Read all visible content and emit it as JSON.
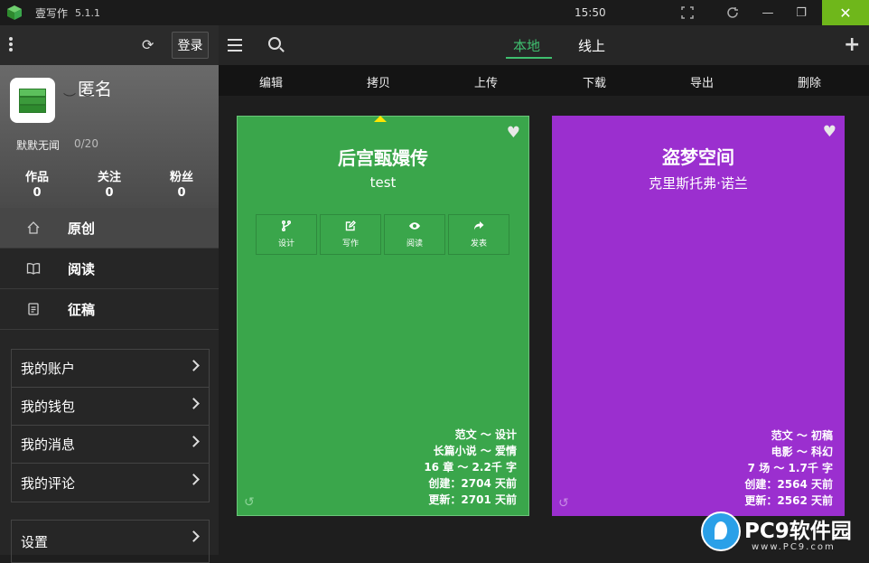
{
  "window": {
    "title": "壹写作",
    "version": "5.1.1",
    "clock": "15:50",
    "minimize": "—",
    "restore": "❐",
    "close": "✕"
  },
  "sidebar": {
    "login": "登录",
    "user": {
      "name": "匿名",
      "motto": "默默无闻",
      "motto_count": "0/20"
    },
    "stats": [
      {
        "label": "作品",
        "value": "0"
      },
      {
        "label": "关注",
        "value": "0"
      },
      {
        "label": "粉丝",
        "value": "0"
      }
    ],
    "nav": [
      {
        "label": "原创",
        "icon": "home-icon",
        "active": true
      },
      {
        "label": "阅读",
        "icon": "book-icon"
      },
      {
        "label": "征稿",
        "icon": "document-icon"
      }
    ],
    "account": [
      "我的账户",
      "我的钱包",
      "我的消息",
      "我的评论"
    ],
    "settings": "设置"
  },
  "topbar": {
    "tabs": [
      "本地",
      "线上"
    ],
    "active_tab": 0
  },
  "toolbar": [
    "编辑",
    "拷贝",
    "上传",
    "下载",
    "导出",
    "删除"
  ],
  "cards": [
    {
      "title": "后宫甄嬛传",
      "subtitle": "test",
      "color": "#3aa64b",
      "actions": [
        {
          "label": "设计",
          "icon": "branch-icon"
        },
        {
          "label": "写作",
          "icon": "edit-icon"
        },
        {
          "label": "阅读",
          "icon": "eye-icon"
        },
        {
          "label": "发表",
          "icon": "share-icon"
        }
      ],
      "meta": [
        "范文 ～ 设计",
        "长篇小说 ～ 爱情",
        "16 章 ～ 2.2千 字",
        "创建：2704 天前",
        "更新：2701 天前"
      ]
    },
    {
      "title": "盗梦空间",
      "subtitle": "克里斯托弗·诺兰",
      "color": "#9b2fcf",
      "meta": [
        "范文 ～ 初稿",
        "电影 ～ 科幻",
        "7 场 ～ 1.7千 字",
        "创建：2564 天前",
        "更新：2562 天前"
      ]
    }
  ],
  "watermark": {
    "text": "PC9软件园",
    "sub": "www.PC9.com"
  }
}
